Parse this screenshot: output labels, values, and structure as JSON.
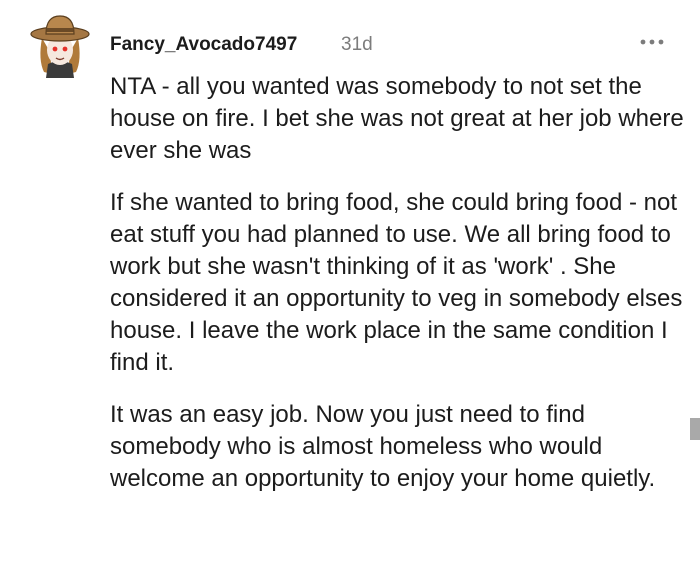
{
  "comment": {
    "author": "Fancy_Avocado7497",
    "age": "31d",
    "more_icon": "ellipsis-horizontal-icon",
    "paragraphs": [
      "NTA - all you wanted was somebody to not set the house on fire. I bet she was not great at her job where ever she was",
      "If she wanted to bring food, she could bring food - not eat stuff you had planned to use. We all bring food to work but she wasn't thinking of it as 'work' . She considered it an opportunity to veg in somebody elses house. I leave the work place in the same condition I find it.",
      "It was an easy job. Now you just need to find somebody who is almost homeless who would welcome an opportunity to enjoy your home quietly."
    ]
  },
  "colors": {
    "text": "#1c1c1c",
    "meta": "#7c7c7c",
    "scrollbar": "#a9a9a9"
  }
}
